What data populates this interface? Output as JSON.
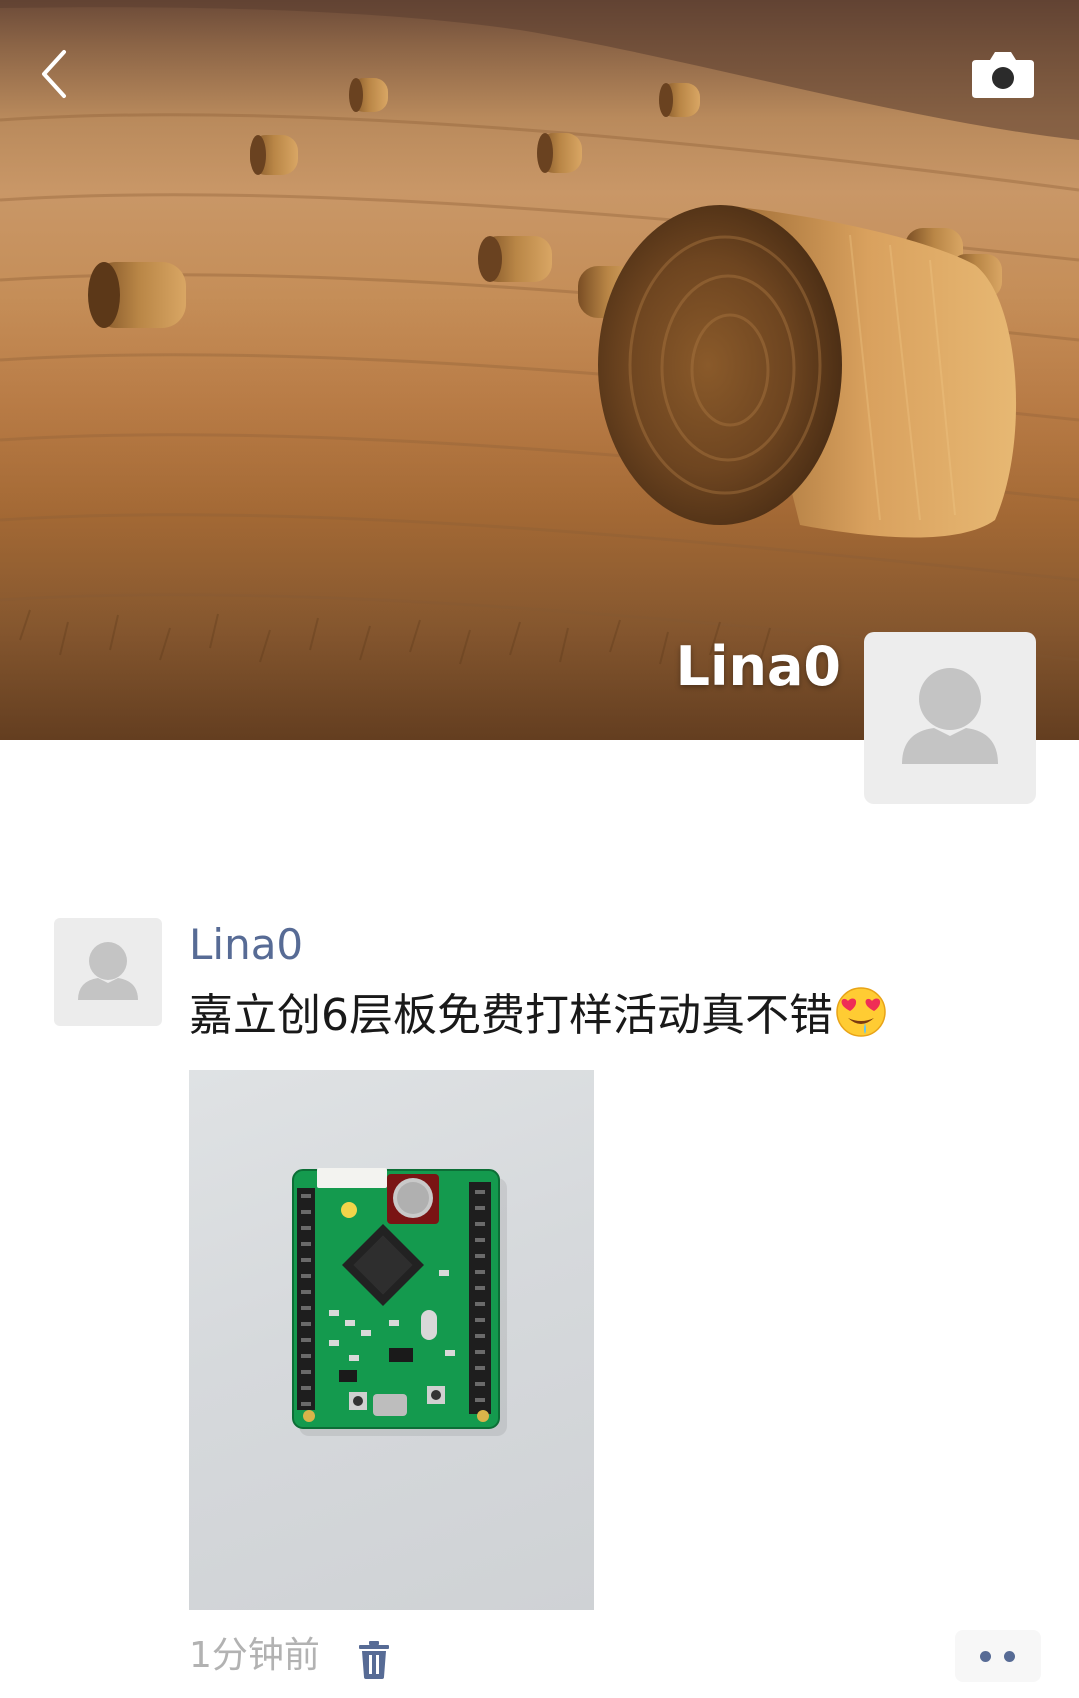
{
  "header": {
    "back_icon": "chevron-left-icon",
    "camera_icon": "camera-icon",
    "cover_image": "hay-bales-field"
  },
  "profile": {
    "name": "Lina0",
    "avatar_icon": "default-user-icon"
  },
  "post": {
    "author": "Lina0",
    "text": "嘉立创6层板免费打样活动真不错",
    "emoji": "star-struck-drooling-emoji",
    "photo": "green-pcb-board",
    "time": "1分钟前",
    "delete_icon": "trash-icon",
    "more_icon": "more-dots-icon"
  },
  "colors": {
    "link": "#576b95",
    "text": "#191919",
    "muted": "#b2b2b2",
    "avatar_bg": "#ececec"
  }
}
